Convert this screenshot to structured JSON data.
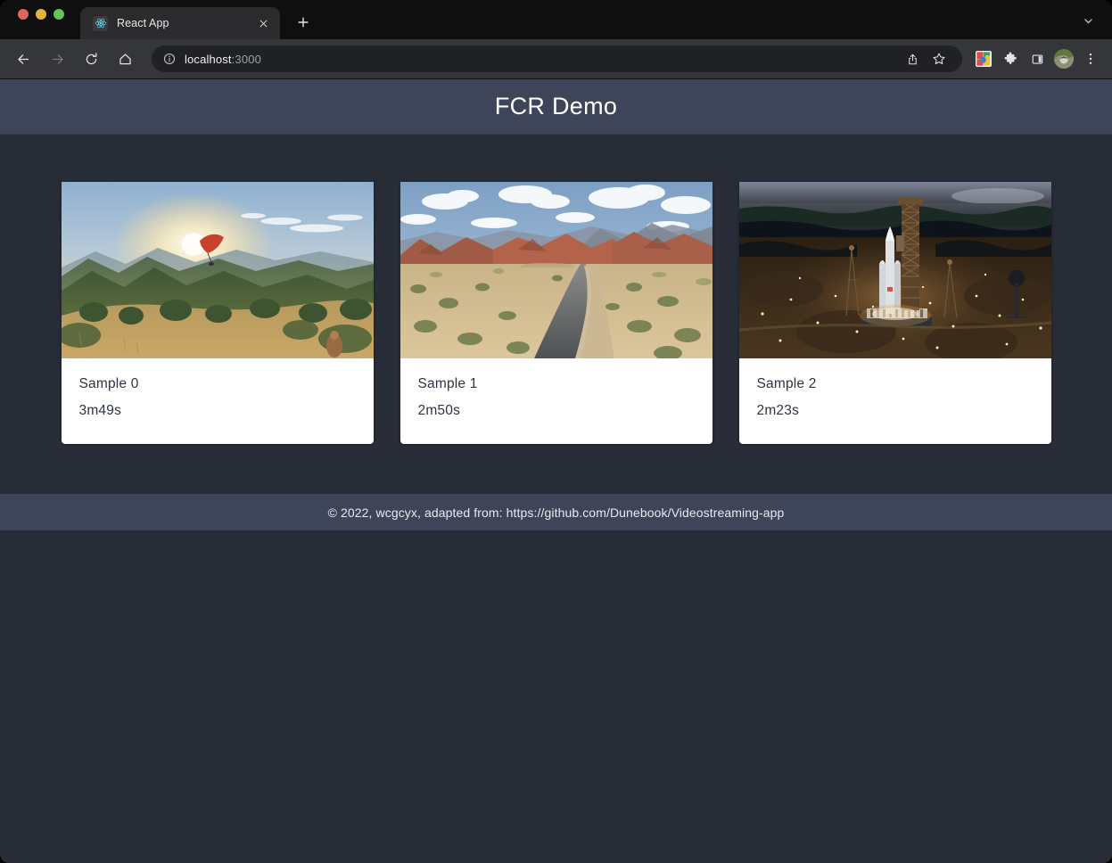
{
  "browser": {
    "tab": {
      "title": "React App",
      "favicon": "react-atom-icon",
      "close_label": "×"
    },
    "new_tab_label": "+",
    "tab_list_label": "⌄",
    "toolbar": {
      "back_label": "←",
      "forward_label": "→",
      "reload_label": "⟳",
      "home_label": "⌂",
      "share_label": "share-icon",
      "bookmark_label": "star-icon",
      "extension_label": "extension-colorful-icon",
      "puzzle_label": "puzzle-icon",
      "side_panel_label": "side-panel-icon",
      "profile_label": "avatar-icon",
      "menu_label": "⋮"
    },
    "omnibox": {
      "host": "localhost",
      "port": ":3000",
      "info_label": "ⓘ"
    }
  },
  "page": {
    "header": {
      "title": "FCR Demo"
    },
    "footer": {
      "text": "© 2022, wcgcyx, adapted from: https://github.com/Dunebook/Videostreaming-app"
    },
    "cards": [
      {
        "title": "Sample 0",
        "duration": "3m49s",
        "thumbnail": "mountain-sunset-paraglider"
      },
      {
        "title": "Sample 1",
        "duration": "2m50s",
        "thumbnail": "desert-road-red-rocks"
      },
      {
        "title": "Sample 2",
        "duration": "2m23s",
        "thumbnail": "rocket-launchpad-night"
      }
    ]
  },
  "colors": {
    "header_bg": "#3e4559",
    "page_bg": "#282c37",
    "card_bg": "#ffffff",
    "card_text": "#2d3340",
    "footer_bg": "#3e4559",
    "browser_toolbar": "#35363a",
    "tab_strip": "#0f0f0f",
    "react_blue": "#61dafb"
  }
}
